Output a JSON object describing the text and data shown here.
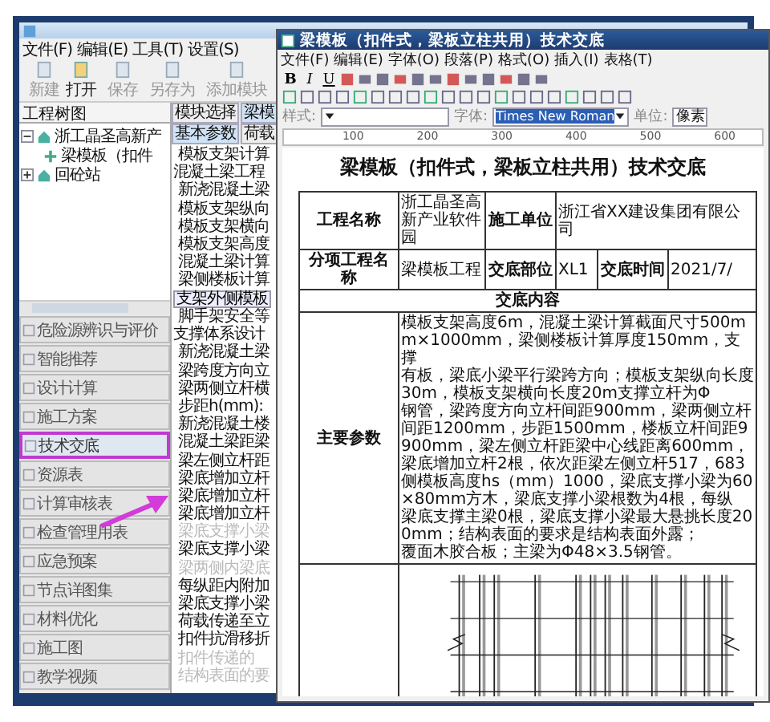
{
  "main_window": {
    "menu": [
      "文件(F)",
      "编辑(E)",
      "工具(T)",
      "设置(S)"
    ],
    "toolbar": [
      {
        "label": "新建",
        "disabled": true
      },
      {
        "label": "打开",
        "disabled": false
      },
      {
        "label": "保存",
        "disabled": true
      },
      {
        "label": "另存为",
        "disabled": true
      },
      {
        "label": "添加模块",
        "disabled": true
      }
    ],
    "tree_header": "工程树图",
    "tree": [
      {
        "label": "浙工晶圣高新产",
        "expanded": true,
        "children": [
          {
            "label": "梁模板（扣件"
          }
        ]
      },
      {
        "label": "回砼站",
        "expanded": false
      }
    ],
    "nav": [
      {
        "label": "危险源辨识与评价",
        "selected": false
      },
      {
        "label": "智能推荐",
        "selected": false
      },
      {
        "label": "设计计算",
        "selected": false
      },
      {
        "label": "施工方案",
        "selected": false
      },
      {
        "label": "技术交底",
        "selected": true
      },
      {
        "label": "资源表",
        "selected": false
      },
      {
        "label": "计算审核表",
        "selected": false
      },
      {
        "label": "检查管理用表",
        "selected": false
      },
      {
        "label": "应急预案",
        "selected": false
      },
      {
        "label": "节点详图集",
        "selected": false
      },
      {
        "label": "材料优化",
        "selected": false
      },
      {
        "label": "施工图",
        "selected": false
      },
      {
        "label": "教学视频",
        "selected": false
      }
    ],
    "module_tabs": [
      {
        "label": "模块选择",
        "selected": false
      },
      {
        "label": "梁模",
        "selected": true
      }
    ],
    "param_tabs": [
      {
        "label": "基本参数",
        "selected": true
      },
      {
        "label": "荷载",
        "selected": false
      }
    ],
    "params": [
      {
        "kind": "field",
        "label": "模板支架计算"
      },
      {
        "kind": "header",
        "label": "混凝土梁工程"
      },
      {
        "kind": "field",
        "label": "新浇混凝土梁"
      },
      {
        "kind": "field",
        "label": "模板支架纵向"
      },
      {
        "kind": "field",
        "label": "模板支架横向"
      },
      {
        "kind": "field",
        "label": "模板支架高度"
      },
      {
        "kind": "field",
        "label": "混凝土梁计算"
      },
      {
        "kind": "field",
        "label": "梁侧楼板计算"
      },
      {
        "kind": "button",
        "label": "支架外侧模板"
      },
      {
        "kind": "field",
        "label": "脚手架安全等"
      },
      {
        "kind": "header",
        "label": "支撑体系设计"
      },
      {
        "kind": "field",
        "label": "新浇混凝土梁"
      },
      {
        "kind": "field",
        "label": "梁跨度方向立"
      },
      {
        "kind": "field",
        "label": "梁两侧立杆横"
      },
      {
        "kind": "field",
        "label": "步距h(mm):"
      },
      {
        "kind": "field",
        "label": "新浇混凝土楼"
      },
      {
        "kind": "field",
        "label": "混凝土梁距梁"
      },
      {
        "kind": "field",
        "label": "梁左侧立杆距"
      },
      {
        "kind": "field",
        "label": "梁底增加立杆"
      },
      {
        "kind": "field",
        "label": "梁底增加立杆"
      },
      {
        "kind": "field",
        "label": "梁底增加立杆"
      },
      {
        "kind": "disabled",
        "label": "梁底支撑小梁"
      },
      {
        "kind": "field",
        "label": "梁底支撑小梁"
      },
      {
        "kind": "disabled",
        "label": "梁两侧内梁底"
      },
      {
        "kind": "field",
        "label": "每纵距内附加"
      },
      {
        "kind": "field",
        "label": "梁底支撑小梁"
      },
      {
        "kind": "field",
        "label": "荷载传递至立"
      },
      {
        "kind": "field",
        "label": "扣件抗滑移折"
      },
      {
        "kind": "disabled",
        "label": "扣件传递的"
      },
      {
        "kind": "disabled",
        "label": "结构表面的要"
      }
    ]
  },
  "doc_window": {
    "title": "梁模板（扣件式，梁板立柱共用）技术交底",
    "menu": [
      "文件(F)",
      "编辑(E)",
      "字体(O)",
      "段落(P)",
      "格式(O)",
      "插入(I)",
      "表格(T)"
    ],
    "format_letters": [
      "B",
      "I",
      "U"
    ],
    "style_label": "样式:",
    "font_label": "字体:",
    "font_value": "Times New Roman",
    "unit_label": "单位:",
    "unit_value": "像素",
    "ruler": [
      "100",
      "200",
      "300",
      "400",
      "500",
      "600"
    ],
    "document": {
      "heading": "梁模板（扣件式，梁板立柱共用）技术交底",
      "project_label": "工程名称",
      "project_value": "浙工晶圣高新产业软件园",
      "builder_label": "施工单位",
      "builder_value": "浙江省XX建设集团有限公司",
      "item_label": "分项工程名称",
      "item_value": "梁模板工程",
      "part_label": "交底部位",
      "part_value": "XL1",
      "time_label": "交底时间",
      "time_value": "2021/7/",
      "content_heading": "交底内容",
      "params_label": "主要参数",
      "params_lines": [
        "模板支架高度6m，混凝土梁计算截面尺寸500mm×1000mm，梁侧楼板计算厚度150mm，支撑",
        "有板，梁底小梁平行梁跨方向；模板支架纵向长度30m，模板支架横向长度20m支撑立杆为Φ",
        "钢管，梁跨度方向立杆间距900mm，梁两侧立杆间距1200mm，步距1500mm，楼板立杆间距9",
        "900mm，梁左侧立杆距梁中心线距离600mm，梁底增加立杆2根，依次距梁左侧立杆517，683",
        "侧模板高度hs（mm）1000，梁底支撑小梁为60×80mm方木，梁底支撑小梁根数为4根，每纵",
        "梁底支撑主梁0根，梁底支撑小梁最大悬挑长度200mm；结构表面的要求是结构表面外露；",
        "覆面木胶合板；主梁为Φ48×3.5钢管。"
      ]
    }
  }
}
